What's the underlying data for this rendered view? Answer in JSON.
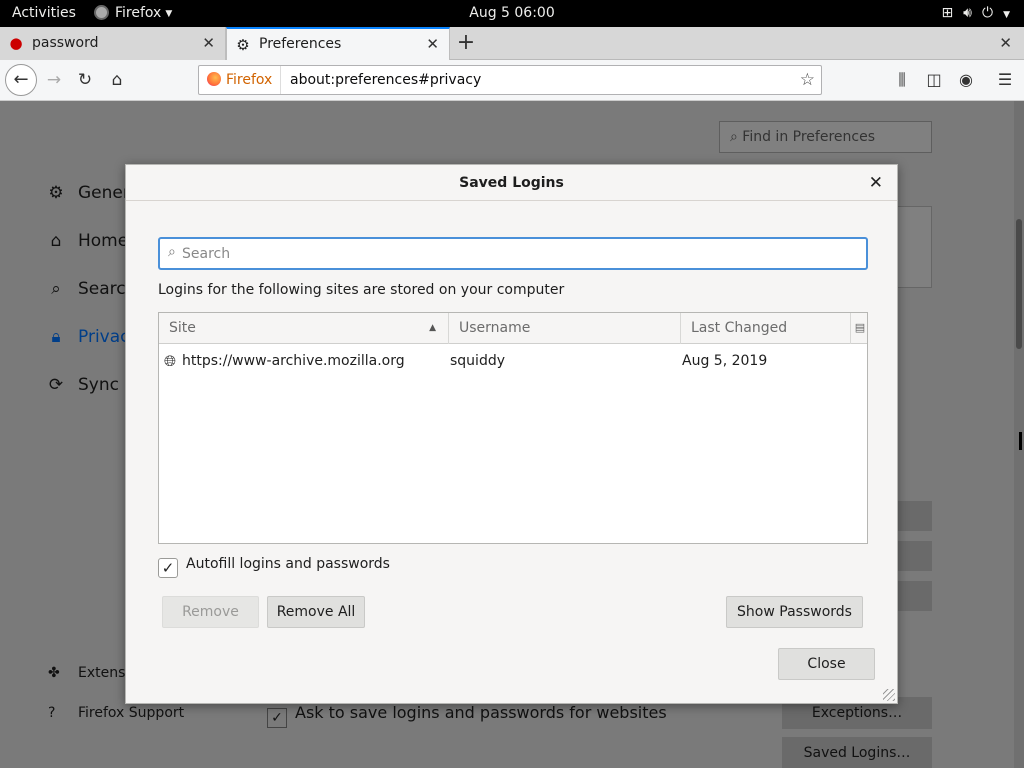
{
  "topbar": {
    "activities": "Activities",
    "app_name": "Firefox",
    "clock": "Aug 5  06:00"
  },
  "tabs": [
    {
      "label": "password",
      "icon": "redhat-icon",
      "active": false
    },
    {
      "label": "Preferences",
      "icon": "gear-icon",
      "active": true
    }
  ],
  "urlbar": {
    "identity": "Firefox",
    "url": "about:preferences#privacy"
  },
  "prefs": {
    "search_placeholder": "Find in Preferences",
    "nav": [
      {
        "label": "General",
        "icon": "gear-icon"
      },
      {
        "label": "Home",
        "icon": "home-icon"
      },
      {
        "label": "Search",
        "icon": "search-icon"
      },
      {
        "label": "Privacy & Security",
        "icon": "lock-icon"
      },
      {
        "label": "Sync",
        "icon": "sync-icon"
      }
    ],
    "footer_nav": [
      {
        "label": "Extensions & Themes",
        "icon": "puzzle-icon"
      },
      {
        "label": "Firefox Support",
        "icon": "help-icon"
      }
    ],
    "ask_to_save": "Ask to save logins and passwords for websites",
    "exceptions_button": "Exceptions…",
    "saved_logins_button": "Saved Logins…"
  },
  "dialog": {
    "title": "Saved Logins",
    "search_placeholder": "Search",
    "intro": "Logins for the following sites are stored on your computer",
    "columns": {
      "site": "Site",
      "username": "Username",
      "last_changed": "Last Changed"
    },
    "rows": [
      {
        "site": "https://www-archive.mozilla.org",
        "username": "squiddy",
        "last_changed": "Aug 5, 2019"
      }
    ],
    "autofill_label": "Autofill logins and passwords",
    "autofill_checked": true,
    "remove_button": "Remove",
    "remove_all_button": "Remove All",
    "show_passwords_button": "Show Passwords",
    "close_button": "Close"
  }
}
